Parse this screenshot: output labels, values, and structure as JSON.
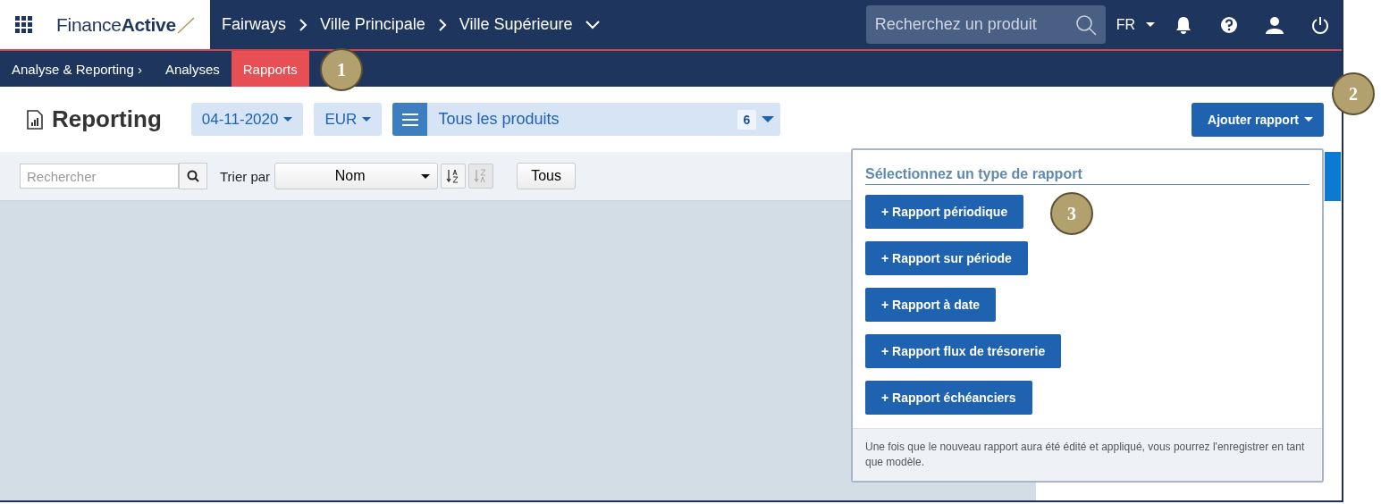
{
  "logo": {
    "name": "Finance",
    "name_bold": "Active"
  },
  "breadcrumb": [
    "Fairways",
    "Ville Principale",
    "Ville Supérieure"
  ],
  "search": {
    "placeholder": "Recherchez un produit"
  },
  "language": "FR",
  "subnav": [
    {
      "label": "Analyse & Reporting ›",
      "selected": false
    },
    {
      "label": "Analyses",
      "selected": false
    },
    {
      "label": "Rapports",
      "selected": true
    }
  ],
  "page_title": "Reporting",
  "date": "04-11-2020",
  "currency": "EUR",
  "products": {
    "label": "Tous les produits",
    "count": "6"
  },
  "add_button": "Ajouter rapport",
  "toolbar": {
    "search_placeholder": "Rechercher",
    "sort_label": "Trier par",
    "sort_value": "Nom",
    "filter": "Tous"
  },
  "menu": {
    "title": "Sélectionnez un type de rapport",
    "items": [
      "+ Rapport périodique",
      "+ Rapport sur période",
      "+ Rapport à date",
      "+ Rapport flux de trésorerie",
      "+ Rapport échéanciers"
    ],
    "note": "Une fois que le nouveau rapport aura été édité et appliqué, vous pourrez l'enregistrer en tant que modèle."
  },
  "callouts": [
    "1",
    "2",
    "3"
  ]
}
